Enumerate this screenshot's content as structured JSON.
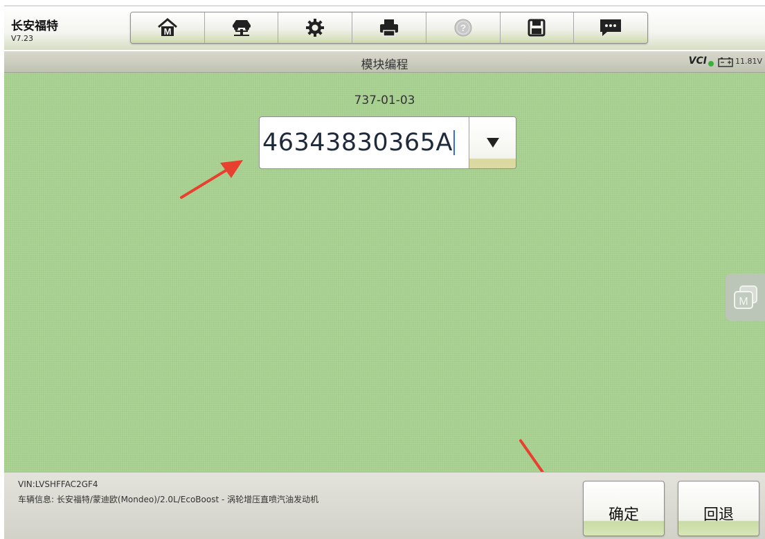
{
  "header": {
    "app_name": "长安福特",
    "version": "V7.23"
  },
  "toolbar": {
    "buttons": [
      {
        "name": "home",
        "icon": "home-icon"
      },
      {
        "name": "vehicle",
        "icon": "car-lift-icon"
      },
      {
        "name": "settings",
        "icon": "gear-icon"
      },
      {
        "name": "print",
        "icon": "printer-icon"
      },
      {
        "name": "help",
        "icon": "help-icon"
      },
      {
        "name": "save",
        "icon": "floppy-disk-icon"
      },
      {
        "name": "feedback",
        "icon": "chat-icon"
      }
    ]
  },
  "status": {
    "title": "模块编程",
    "vci": "VCI",
    "voltage": "11.81V"
  },
  "main": {
    "label": "737-01-03",
    "combo_value": "46343830365A"
  },
  "footer": {
    "vin": "VIN:LVSHFFAC2GF4",
    "vehicle_info": "车辆信息: 长安福特/蒙迪欧(Mondeo)/2.0L/EcoBoost - 涡轮增压直喷汽油发动机",
    "confirm_label": "确定",
    "back_label": "回退"
  },
  "colors": {
    "main_bg": "#a6cf8f",
    "annotation_arrow": "#e8402f",
    "vci_status": "#3bb13b"
  }
}
